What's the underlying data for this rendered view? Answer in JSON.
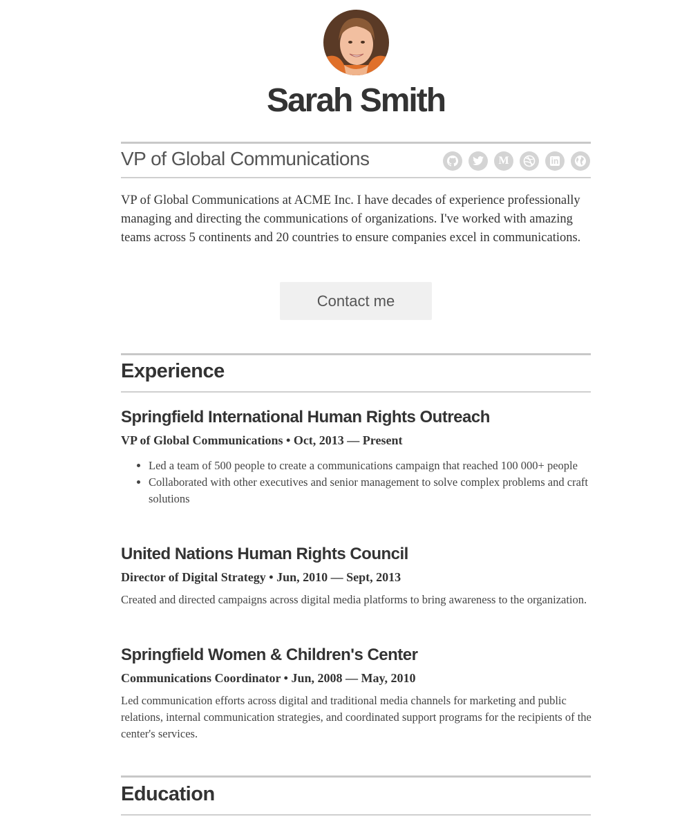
{
  "profile": {
    "name": "Sarah Smith",
    "title": "VP of Global Communications",
    "bio": "VP of Global Communications at ACME Inc. I have decades of experience professionally managing and directing the communications of organizations. I've worked with amazing teams across 5 continents and 20 countries to ensure companies excel in communications.",
    "contact_label": "Contact me"
  },
  "social": {
    "icons": [
      "github-icon",
      "twitter-icon",
      "medium-icon",
      "dribbble-icon",
      "linkedin-icon",
      "globe-icon"
    ],
    "medium_letter": "M",
    "linkedin_letters": "in"
  },
  "colors": {
    "text": "#333333",
    "rule": "#c8c8c8",
    "icon_bg": "#d4d4d4",
    "button_bg": "#f0f0f0"
  },
  "experience": {
    "heading": "Experience",
    "jobs": [
      {
        "org": "Springfield International Human Rights Outreach",
        "role_line": "VP of Global Communications • Oct, 2013 — Present",
        "bullets": [
          "Led a team of 500 people to create a communications campaign that reached 100 000+ people",
          "Collaborated with other executives and senior management to solve complex problems and craft solutions"
        ]
      },
      {
        "org": "United Nations Human Rights Council",
        "role_line": "Director of Digital Strategy • Jun, 2010 — Sept, 2013",
        "description": "Created and directed campaigns across digital media platforms to bring awareness to the organization."
      },
      {
        "org": "Springfield Women & Children's Center",
        "role_line": "Communications Coordinator • Jun, 2008 — May, 2010",
        "description": "Led communication efforts across digital and traditional media channels for marketing and public relations, internal communication strategies, and coordinated support programs for the recipients of the center's services."
      }
    ]
  },
  "education": {
    "heading": "Education"
  }
}
